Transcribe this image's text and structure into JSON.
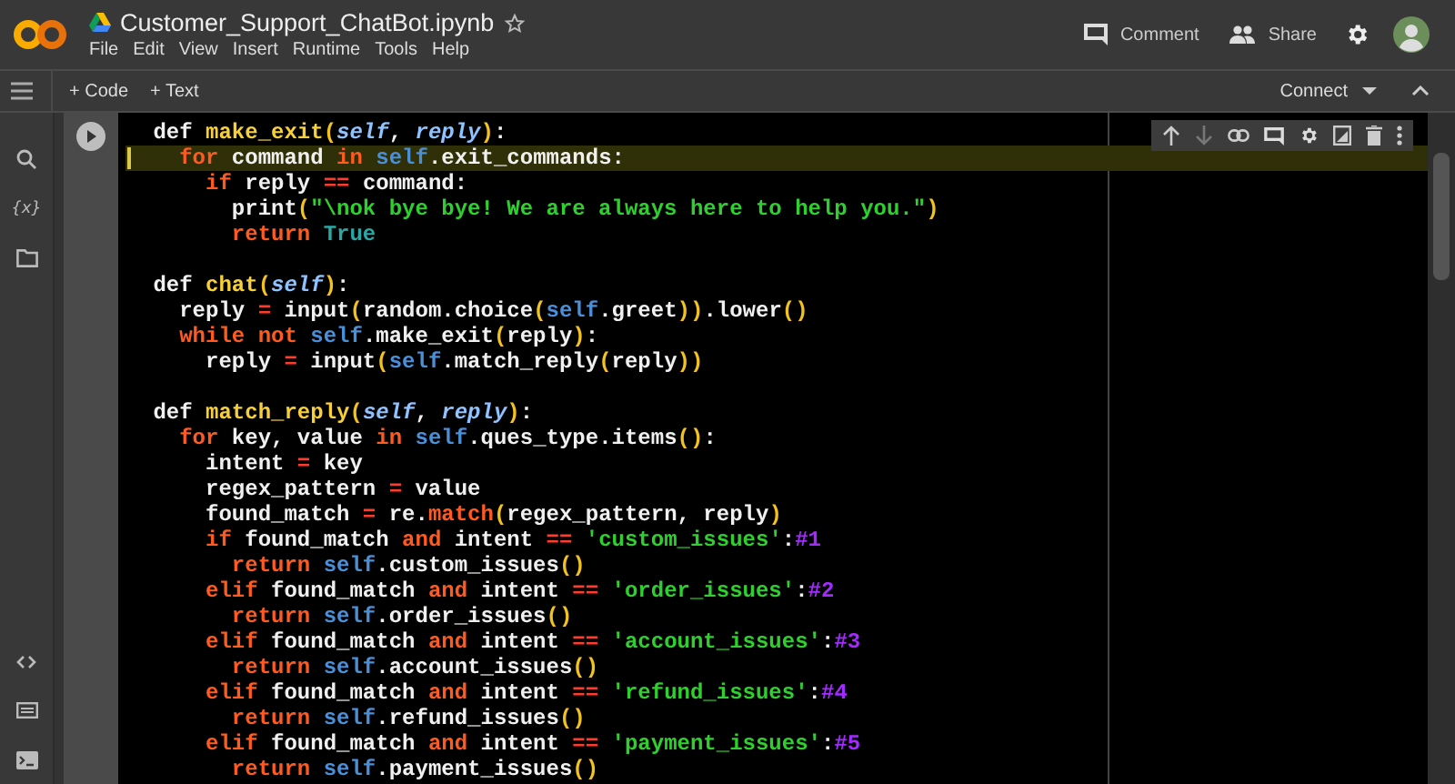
{
  "header": {
    "title": "Customer_Support_ChatBot.ipynb",
    "menu": [
      "File",
      "Edit",
      "View",
      "Insert",
      "Runtime",
      "Tools",
      "Help"
    ],
    "comment_button": "Comment",
    "share_button": "Share"
  },
  "toolbar": {
    "buttons": [
      "+ Code",
      "+ Text"
    ],
    "connect_button": "Connect"
  },
  "sidebar": {
    "variables_icon": "{x}"
  },
  "cell": {
    "lines": [
      {
        "current": false,
        "tokens": [
          {
            "kind": "plain",
            "text": "def "
          },
          {
            "kind": "fn",
            "text": "make_exit"
          },
          {
            "kind": "paren",
            "text": "("
          },
          {
            "kind": "param",
            "text": "self"
          },
          {
            "kind": "plain",
            "text": ", "
          },
          {
            "kind": "param",
            "text": "reply"
          },
          {
            "kind": "paren",
            "text": ")"
          },
          {
            "kind": "plain",
            "text": ":"
          }
        ]
      },
      {
        "current": true,
        "tokens": [
          {
            "kind": "kw",
            "text": "  for"
          },
          {
            "kind": "plain",
            "text": " command "
          },
          {
            "kind": "kw",
            "text": "in "
          },
          {
            "kind": "self",
            "text": "self"
          },
          {
            "kind": "plain",
            "text": ".exit_commands:"
          }
        ]
      },
      {
        "current": false,
        "tokens": [
          {
            "kind": "kw",
            "text": "    if"
          },
          {
            "kind": "plain",
            "text": " reply "
          },
          {
            "kind": "op",
            "text": "=="
          },
          {
            "kind": "plain",
            "text": " command:"
          }
        ]
      },
      {
        "current": false,
        "tokens": [
          {
            "kind": "plain",
            "text": "      print"
          },
          {
            "kind": "paren",
            "text": "("
          },
          {
            "kind": "str",
            "text": "\"\\nok bye bye! We are always here to help you.\""
          },
          {
            "kind": "paren",
            "text": ")"
          }
        ]
      },
      {
        "current": false,
        "tokens": [
          {
            "kind": "kw",
            "text": "      return "
          },
          {
            "kind": "const",
            "text": "True"
          }
        ]
      },
      {
        "current": false
      },
      {
        "current": false,
        "tokens": [
          {
            "kind": "plain",
            "text": "def "
          },
          {
            "kind": "fn",
            "text": "chat"
          },
          {
            "kind": "paren",
            "text": "("
          },
          {
            "kind": "param",
            "text": "self"
          },
          {
            "kind": "paren",
            "text": ")"
          },
          {
            "kind": "plain",
            "text": ":"
          }
        ]
      },
      {
        "current": false,
        "tokens": [
          {
            "kind": "plain",
            "text": "  reply "
          },
          {
            "kind": "op",
            "text": "="
          },
          {
            "kind": "plain",
            "text": " input"
          },
          {
            "kind": "paren",
            "text": "("
          },
          {
            "kind": "plain",
            "text": "random.choice"
          },
          {
            "kind": "paren",
            "text": "("
          },
          {
            "kind": "self",
            "text": "self"
          },
          {
            "kind": "plain",
            "text": ".greet"
          },
          {
            "kind": "paren",
            "text": "))"
          },
          {
            "kind": "plain",
            "text": ".lower"
          },
          {
            "kind": "paren",
            "text": "()"
          }
        ]
      },
      {
        "current": false,
        "tokens": [
          {
            "kind": "kw",
            "text": "  while not "
          },
          {
            "kind": "self",
            "text": "self"
          },
          {
            "kind": "plain",
            "text": ".make_exit"
          },
          {
            "kind": "paren",
            "text": "("
          },
          {
            "kind": "plain",
            "text": "reply"
          },
          {
            "kind": "paren",
            "text": ")"
          },
          {
            "kind": "plain",
            "text": ":"
          }
        ]
      },
      {
        "current": false,
        "tokens": [
          {
            "kind": "plain",
            "text": "    reply "
          },
          {
            "kind": "op",
            "text": "="
          },
          {
            "kind": "plain",
            "text": " input"
          },
          {
            "kind": "paren",
            "text": "("
          },
          {
            "kind": "self",
            "text": "self"
          },
          {
            "kind": "plain",
            "text": ".match_reply"
          },
          {
            "kind": "paren",
            "text": "("
          },
          {
            "kind": "plain",
            "text": "reply"
          },
          {
            "kind": "paren",
            "text": "))"
          }
        ]
      },
      {
        "current": false
      },
      {
        "current": false,
        "tokens": [
          {
            "kind": "plain",
            "text": "def "
          },
          {
            "kind": "fn",
            "text": "match_reply"
          },
          {
            "kind": "paren",
            "text": "("
          },
          {
            "kind": "param",
            "text": "self"
          },
          {
            "kind": "plain",
            "text": ", "
          },
          {
            "kind": "param",
            "text": "reply"
          },
          {
            "kind": "paren",
            "text": ")"
          },
          {
            "kind": "plain",
            "text": ":"
          }
        ]
      },
      {
        "current": false,
        "tokens": [
          {
            "kind": "kw",
            "text": "  for"
          },
          {
            "kind": "plain",
            "text": " key, value "
          },
          {
            "kind": "kw",
            "text": "in "
          },
          {
            "kind": "self",
            "text": "self"
          },
          {
            "kind": "plain",
            "text": ".ques_type.items"
          },
          {
            "kind": "paren",
            "text": "()"
          },
          {
            "kind": "plain",
            "text": ":"
          }
        ]
      },
      {
        "current": false,
        "tokens": [
          {
            "kind": "plain",
            "text": "    intent "
          },
          {
            "kind": "op",
            "text": "="
          },
          {
            "kind": "plain",
            "text": " key"
          }
        ]
      },
      {
        "current": false,
        "tokens": [
          {
            "kind": "plain",
            "text": "    regex_pattern "
          },
          {
            "kind": "op",
            "text": "="
          },
          {
            "kind": "plain",
            "text": " value"
          }
        ]
      },
      {
        "current": false,
        "tokens": [
          {
            "kind": "plain",
            "text": "    found_match "
          },
          {
            "kind": "op",
            "text": "="
          },
          {
            "kind": "plain",
            "text": " re."
          },
          {
            "kind": "kw",
            "text": "match"
          },
          {
            "kind": "paren",
            "text": "("
          },
          {
            "kind": "plain",
            "text": "regex_pattern, reply"
          },
          {
            "kind": "paren",
            "text": ")"
          }
        ]
      },
      {
        "current": false,
        "tokens": [
          {
            "kind": "kw",
            "text": "    if"
          },
          {
            "kind": "plain",
            "text": " found_match "
          },
          {
            "kind": "kw",
            "text": "and"
          },
          {
            "kind": "plain",
            "text": " intent "
          },
          {
            "kind": "op",
            "text": "== "
          },
          {
            "kind": "str",
            "text": "'custom_issues'"
          },
          {
            "kind": "plain",
            "text": ":"
          },
          {
            "kind": "comment",
            "text": "#1"
          }
        ]
      },
      {
        "current": false,
        "tokens": [
          {
            "kind": "kw",
            "text": "      return "
          },
          {
            "kind": "self",
            "text": "self"
          },
          {
            "kind": "plain",
            "text": ".custom_issues"
          },
          {
            "kind": "paren",
            "text": "()"
          }
        ]
      },
      {
        "current": false,
        "tokens": [
          {
            "kind": "kw",
            "text": "    elif"
          },
          {
            "kind": "plain",
            "text": " found_match "
          },
          {
            "kind": "kw",
            "text": "and"
          },
          {
            "kind": "plain",
            "text": " intent "
          },
          {
            "kind": "op",
            "text": "== "
          },
          {
            "kind": "str",
            "text": "'order_issues'"
          },
          {
            "kind": "plain",
            "text": ":"
          },
          {
            "kind": "comment",
            "text": "#2"
          }
        ]
      },
      {
        "current": false,
        "tokens": [
          {
            "kind": "kw",
            "text": "      return "
          },
          {
            "kind": "self",
            "text": "self"
          },
          {
            "kind": "plain",
            "text": ".order_issues"
          },
          {
            "kind": "paren",
            "text": "()"
          }
        ]
      },
      {
        "current": false,
        "tokens": [
          {
            "kind": "kw",
            "text": "    elif"
          },
          {
            "kind": "plain",
            "text": " found_match "
          },
          {
            "kind": "kw",
            "text": "and"
          },
          {
            "kind": "plain",
            "text": " intent "
          },
          {
            "kind": "op",
            "text": "== "
          },
          {
            "kind": "str",
            "text": "'account_issues'"
          },
          {
            "kind": "plain",
            "text": ":"
          },
          {
            "kind": "comment",
            "text": "#3"
          }
        ]
      },
      {
        "current": false,
        "tokens": [
          {
            "kind": "kw",
            "text": "      return "
          },
          {
            "kind": "self",
            "text": "self"
          },
          {
            "kind": "plain",
            "text": ".account_issues"
          },
          {
            "kind": "paren",
            "text": "()"
          }
        ]
      },
      {
        "current": false,
        "tokens": [
          {
            "kind": "kw",
            "text": "    elif"
          },
          {
            "kind": "plain",
            "text": " found_match "
          },
          {
            "kind": "kw",
            "text": "and"
          },
          {
            "kind": "plain",
            "text": " intent "
          },
          {
            "kind": "op",
            "text": "== "
          },
          {
            "kind": "str",
            "text": "'refund_issues'"
          },
          {
            "kind": "plain",
            "text": ":"
          },
          {
            "kind": "comment",
            "text": "#4"
          }
        ]
      },
      {
        "current": false,
        "tokens": [
          {
            "kind": "kw",
            "text": "      return "
          },
          {
            "kind": "self",
            "text": "self"
          },
          {
            "kind": "plain",
            "text": ".refund_issues"
          },
          {
            "kind": "paren",
            "text": "()"
          }
        ]
      },
      {
        "current": false,
        "tokens": [
          {
            "kind": "kw",
            "text": "    elif"
          },
          {
            "kind": "plain",
            "text": " found_match "
          },
          {
            "kind": "kw",
            "text": "and"
          },
          {
            "kind": "plain",
            "text": " intent "
          },
          {
            "kind": "op",
            "text": "== "
          },
          {
            "kind": "str",
            "text": "'payment_issues'"
          },
          {
            "kind": "plain",
            "text": ":"
          },
          {
            "kind": "comment",
            "text": "#5"
          }
        ]
      },
      {
        "current": false,
        "tokens": [
          {
            "kind": "kw",
            "text": "      return "
          },
          {
            "kind": "self",
            "text": "self"
          },
          {
            "kind": "plain",
            "text": ".payment_issues"
          },
          {
            "kind": "paren",
            "text": "()"
          }
        ]
      }
    ]
  }
}
